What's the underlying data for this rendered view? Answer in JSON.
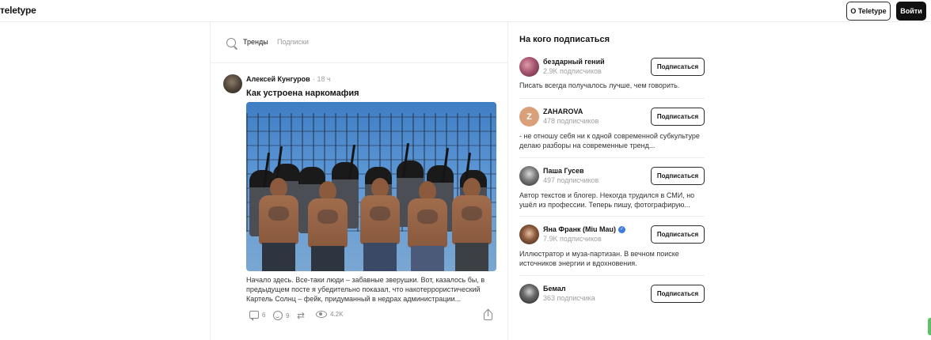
{
  "header": {
    "logo": "тeletype",
    "about_button": "О Teletype",
    "login_button": "Войти"
  },
  "feed": {
    "tabs": [
      {
        "label": "Тренды",
        "active": true
      },
      {
        "label": "Подписки",
        "active": false
      }
    ],
    "post": {
      "author": "Алексей Кунгуров",
      "time": "· 18 ч",
      "title": "Как устроена наркомафия",
      "excerpt": "Начало здесь. Все-таки люди – забавные зверушки. Вот, казалось бы, в предыдущем посте я убедительно показал, что накотеррористический Картель Солнц – фейк, придуманный в недрах администрации...",
      "stats": {
        "comments": "6",
        "reactions": "9",
        "views": "4.2K"
      }
    }
  },
  "sidebar": {
    "title": "На кого подписаться",
    "subscribe_label": "Подписаться",
    "authors": [
      {
        "name": "бездарный гений",
        "subs": "2.9K подписчиков",
        "desc": "Писать всегда получалось лучше, чем говорить.",
        "verified": false,
        "avatar_color": "#a0506a"
      },
      {
        "name": "ZAHAROVA",
        "subs": "478 подписчиков",
        "desc": "- не отношу себя ни к одной современной субкультуре делаю разборы на современные тренд...",
        "verified": false,
        "avatar_letter": "Z",
        "avatar_color": "#d9a07a"
      },
      {
        "name": "Паша Гусев",
        "subs": "497 подписчиков",
        "desc": "Автор текстов и блогер. Некогда трудился в СМИ, но ушёл из профессии. Теперь пишу, фотографирую...",
        "verified": false,
        "avatar_color": "#2b2b2b"
      },
      {
        "name": "Яна Франк (Miu Mau)",
        "subs": "7.9K подписчиков",
        "desc": "Иллюстратор и муза-партизан. В вечном поиске источников энергии и вдохновения.",
        "verified": true,
        "avatar_color": "#6a4a3a"
      },
      {
        "name": "Бемал",
        "subs": "363 подписчика",
        "desc": "",
        "verified": false,
        "avatar_color": "#333333"
      }
    ]
  }
}
